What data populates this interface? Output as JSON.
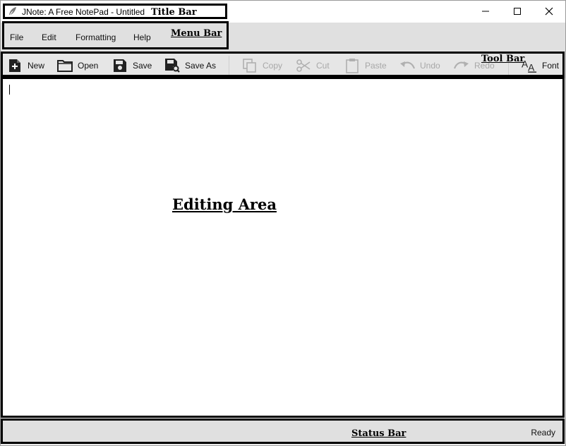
{
  "window": {
    "title": "JNote: A Free NotePad - Untitled",
    "controls": [
      "minimize-icon",
      "maximize-icon",
      "close-icon"
    ]
  },
  "menu": {
    "items": [
      "File",
      "Edit",
      "Formatting",
      "Help"
    ]
  },
  "toolbar": {
    "items": [
      {
        "label": "New",
        "icon": "new-file-icon",
        "enabled": true
      },
      {
        "label": "Open",
        "icon": "folder-icon",
        "enabled": true
      },
      {
        "label": "Save",
        "icon": "save-icon",
        "enabled": true
      },
      {
        "label": "Save As",
        "icon": "save-as-icon",
        "enabled": true
      },
      {
        "label": "Copy",
        "icon": "copy-icon",
        "enabled": false
      },
      {
        "label": "Cut",
        "icon": "scissors-icon",
        "enabled": false
      },
      {
        "label": "Paste",
        "icon": "clipboard-icon",
        "enabled": false
      },
      {
        "label": "Undo",
        "icon": "undo-icon",
        "enabled": false
      },
      {
        "label": "Redo",
        "icon": "redo-icon",
        "enabled": false
      },
      {
        "label": "Font",
        "icon": "font-icon",
        "enabled": true
      }
    ]
  },
  "editor": {
    "content": ""
  },
  "status": {
    "text": "Ready"
  },
  "annotations": {
    "title_bar": "Title Bar",
    "menu_bar": "Menu Bar",
    "tool_bar": "Tool Bar",
    "editing_area": "Editing Area",
    "status_bar": "Status Bar"
  },
  "colors": {
    "bar_background": "#e0e0e0",
    "disabled_text": "#a8a8a8",
    "annotation": "#000000"
  }
}
